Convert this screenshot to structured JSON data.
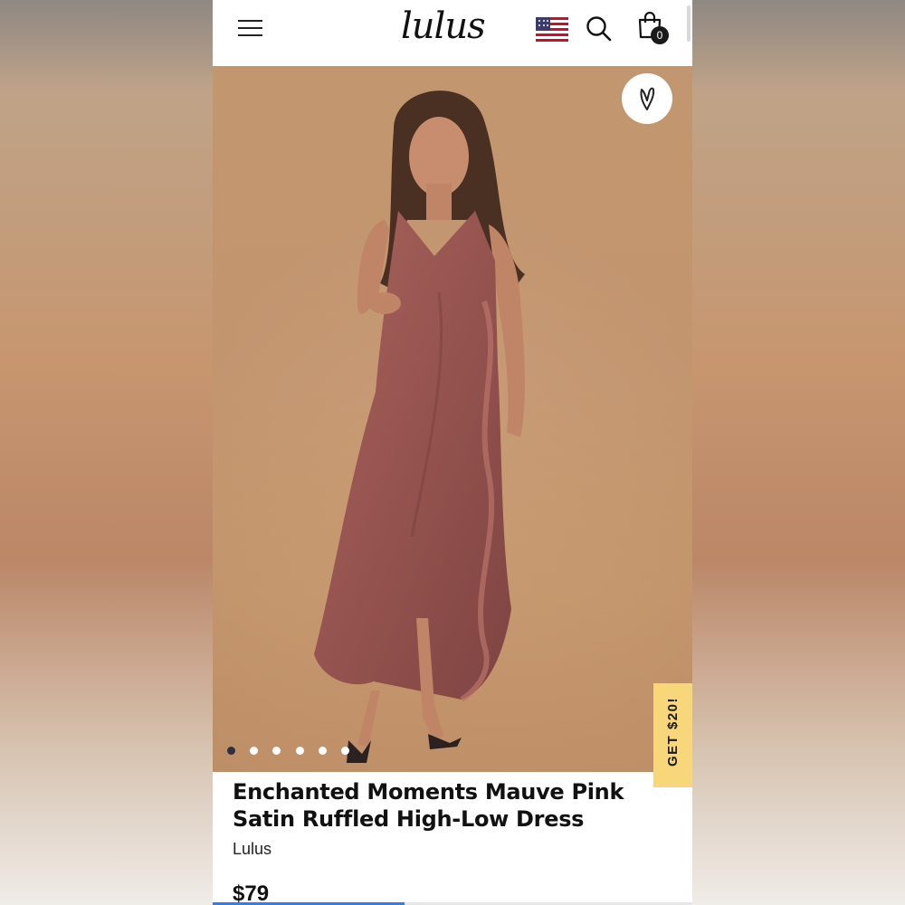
{
  "header": {
    "logo_text": "lulus",
    "cart_count": "0",
    "icons": [
      "menu-icon",
      "flag-icon",
      "search-icon",
      "shopping-bag-icon"
    ]
  },
  "hero": {
    "wishlist_icon": "heart-icon",
    "carousel_total": 6,
    "carousel_active": 1
  },
  "promo": {
    "label": "GET $20!"
  },
  "product": {
    "title": "Enchanted Moments Mauve Pink Satin Ruffled High-Low Dress",
    "brand": "Lulus",
    "price": "$79"
  },
  "scroll_progress": 0.4,
  "colors": {
    "accent": "#3b7bd9",
    "promo_bg": "#f7d77a",
    "dress": "#9b5a55",
    "background": "#c99e79"
  }
}
